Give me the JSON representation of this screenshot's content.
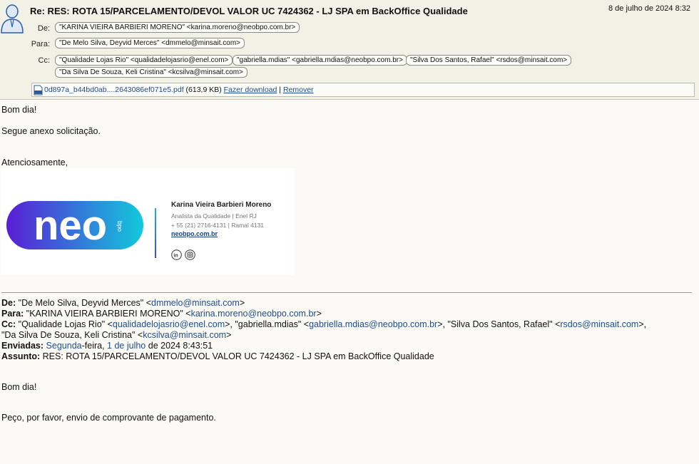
{
  "email": {
    "subject": "Re: RES: ROTA 15/PARCELAMENTO/DEVOL VALOR UC 7424362 - LJ SPA em BackOffice Qualidade",
    "date": "8 de julho de 2024 8:32",
    "labels": {
      "from": "De:",
      "to": "Para:",
      "cc": "Cc:"
    },
    "from": "\"KARINA VIEIRA BARBIERI MORENO\" <karina.moreno@neobpo.com.br>",
    "to": "\"De Melo Silva, Deyvid Merces\" <dmmelo@minsait.com>",
    "cc": [
      "\"Qualidade Lojas Rio\" <qualidadelojasrio@enel.com>",
      "\"gabriella.mdias\" <gabriella.mdias@neobpo.com.br>",
      "\"Silva Dos Santos, Rafael\" <rsdos@minsait.com>",
      "\"Da Silva De Souza, Keli Cristina\" <kcsilva@minsait.com>"
    ],
    "attachment": {
      "filename": "0d897a_b44bd0ab....2643086ef071e5.pdf",
      "size": "(613,9 KB)",
      "download": "Fazer download",
      "separator": "|",
      "remove": "Remover"
    }
  },
  "body": {
    "greeting": "Bom dia!",
    "line1": "Segue anexo solicitação.",
    "closing": "Atenciosamente,"
  },
  "signature": {
    "logo_text": "neo",
    "logo_sub": "bpo",
    "name": "Karina Vieira Barbieri Moreno",
    "role": "Analista da Qualidade | Enel RJ",
    "phone": "+ 55 (21) 2716-4131  |  Ramal 4131",
    "site": "neobpo.com.br",
    "social_icons": [
      "linkedin-icon",
      "instagram-icon"
    ],
    "colors": {
      "logo_start": "#5a1ed6",
      "logo_end": "#12c9dc"
    }
  },
  "quoted": {
    "from_label": "De:",
    "from_name": "\"De Melo Silva, Deyvid Merces\" <",
    "from_email": "dmmelo@minsait.com",
    "from_end": ">",
    "to_label": "Para:",
    "to_name": "\"KARINA VIEIRA BARBIERI MORENO\" <",
    "to_email": "karina.moreno@neobpo.com.br",
    "to_end": ">",
    "cc_label": "Cc:",
    "cc1_name": "\"Qualidade Lojas Rio\" <",
    "cc1_email": "qualidadelojasrio@enel.com",
    "cc1_end": ">, \"gabriella.mdias\" <",
    "cc2_email": "gabriella.mdias@neobpo.com.br",
    "cc2_end": ">, \"Silva Dos Santos, Rafael\" <",
    "cc3_email": "rsdos@minsait.com",
    "cc3_end": ">,",
    "cc4_name": "\"Da Silva De Souza, Keli Cristina\" <",
    "cc4_email": "kcsilva@minsait.com",
    "cc4_end": ">",
    "sent_label": "Enviadas:",
    "sent_day": "Segunda",
    "sent_day_suffix": "-feira, ",
    "sent_date": "1 de julho",
    "sent_rest": " de 2024 8:43:51",
    "subject_label": "Assunto:",
    "subject": "RES: ROTA 15/PARCELAMENTO/DEVOL VALOR UC 7424362 - LJ SPA em BackOffice Qualidade",
    "greeting": "Bom dia!",
    "request": "Peço, por favor, envio de comprovante de pagamento."
  }
}
